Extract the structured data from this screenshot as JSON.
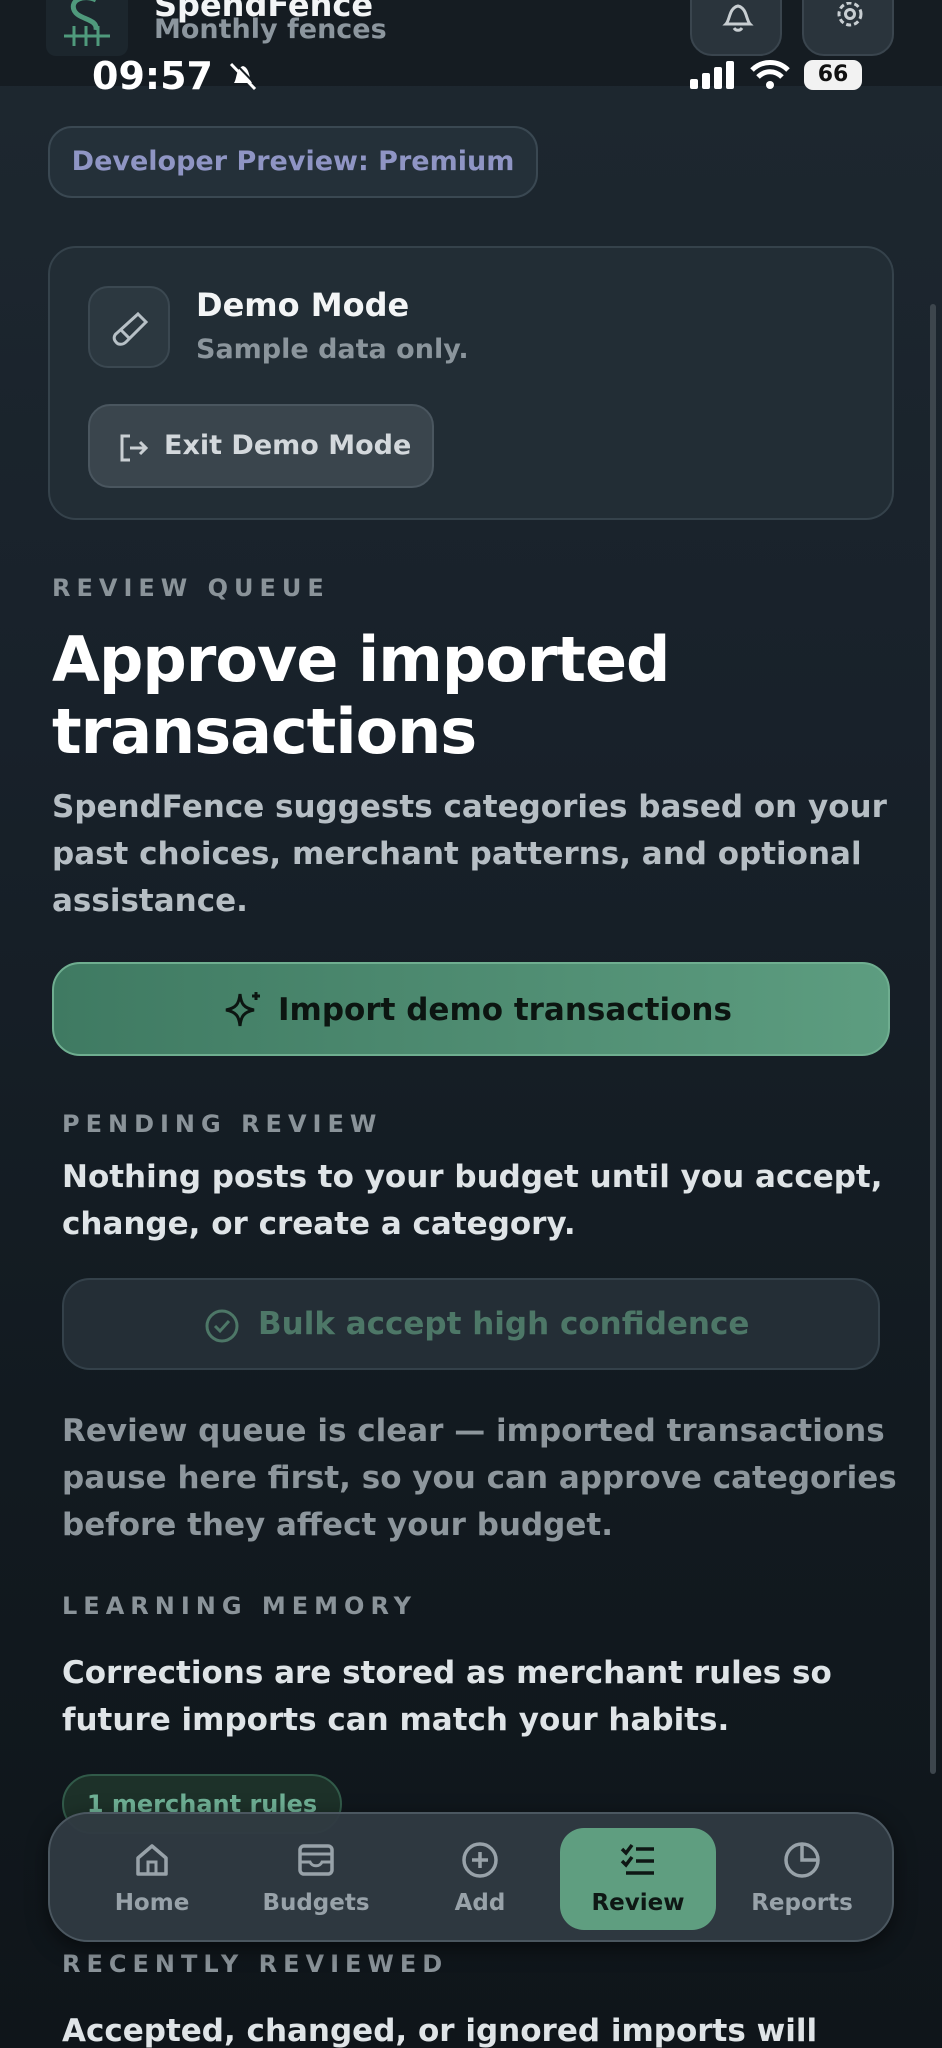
{
  "app": {
    "title": "SpendFence",
    "subtitle": "Monthly fences"
  },
  "status_bar": {
    "time": "09:57",
    "battery": "66"
  },
  "chip": {
    "label": "Developer Preview: Premium"
  },
  "demo": {
    "title": "Demo Mode",
    "subtitle": "Sample data only.",
    "exit_label": "Exit Demo Mode"
  },
  "review_queue": {
    "overline": "REVIEW QUEUE",
    "heading_line1": "Approve imported",
    "heading_line2": "transactions",
    "description_line1": "SpendFence suggests categories based on your",
    "description_line2": "past choices, merchant patterns, and optional",
    "description_line3": "assistance.",
    "import_label": "Import demo transactions"
  },
  "pending_review": {
    "overline": "PENDING REVIEW",
    "line1": "Nothing posts to your budget until you accept,",
    "line2": "change, or create a category.",
    "bulk_label": "Bulk accept high confidence",
    "empty_line1": "Review queue is clear — imported transactions",
    "empty_line2": "pause here first, so you can approve categories",
    "empty_line3": "before they affect your budget."
  },
  "learning_memory": {
    "overline": "LEARNING MEMORY",
    "line1": "Corrections are stored as merchant rules so",
    "line2": "future imports can match your habits.",
    "rules_chip": "1 merchant rules"
  },
  "recently_reviewed": {
    "overline": "RECENTLY REVIEWED",
    "line1": "Accepted, changed, or ignored imports will"
  },
  "tabs": [
    {
      "label": "Home",
      "icon": "home-icon",
      "active": false
    },
    {
      "label": "Budgets",
      "icon": "wallet-icon",
      "active": false
    },
    {
      "label": "Add",
      "icon": "plus-circle-icon",
      "active": false
    },
    {
      "label": "Review",
      "icon": "checklist-icon",
      "active": true
    },
    {
      "label": "Reports",
      "icon": "pie-chart-icon",
      "active": false
    }
  ],
  "colors": {
    "accent": "#5f9e80",
    "chip_text": "#8f95c4",
    "background": "#151c22"
  }
}
